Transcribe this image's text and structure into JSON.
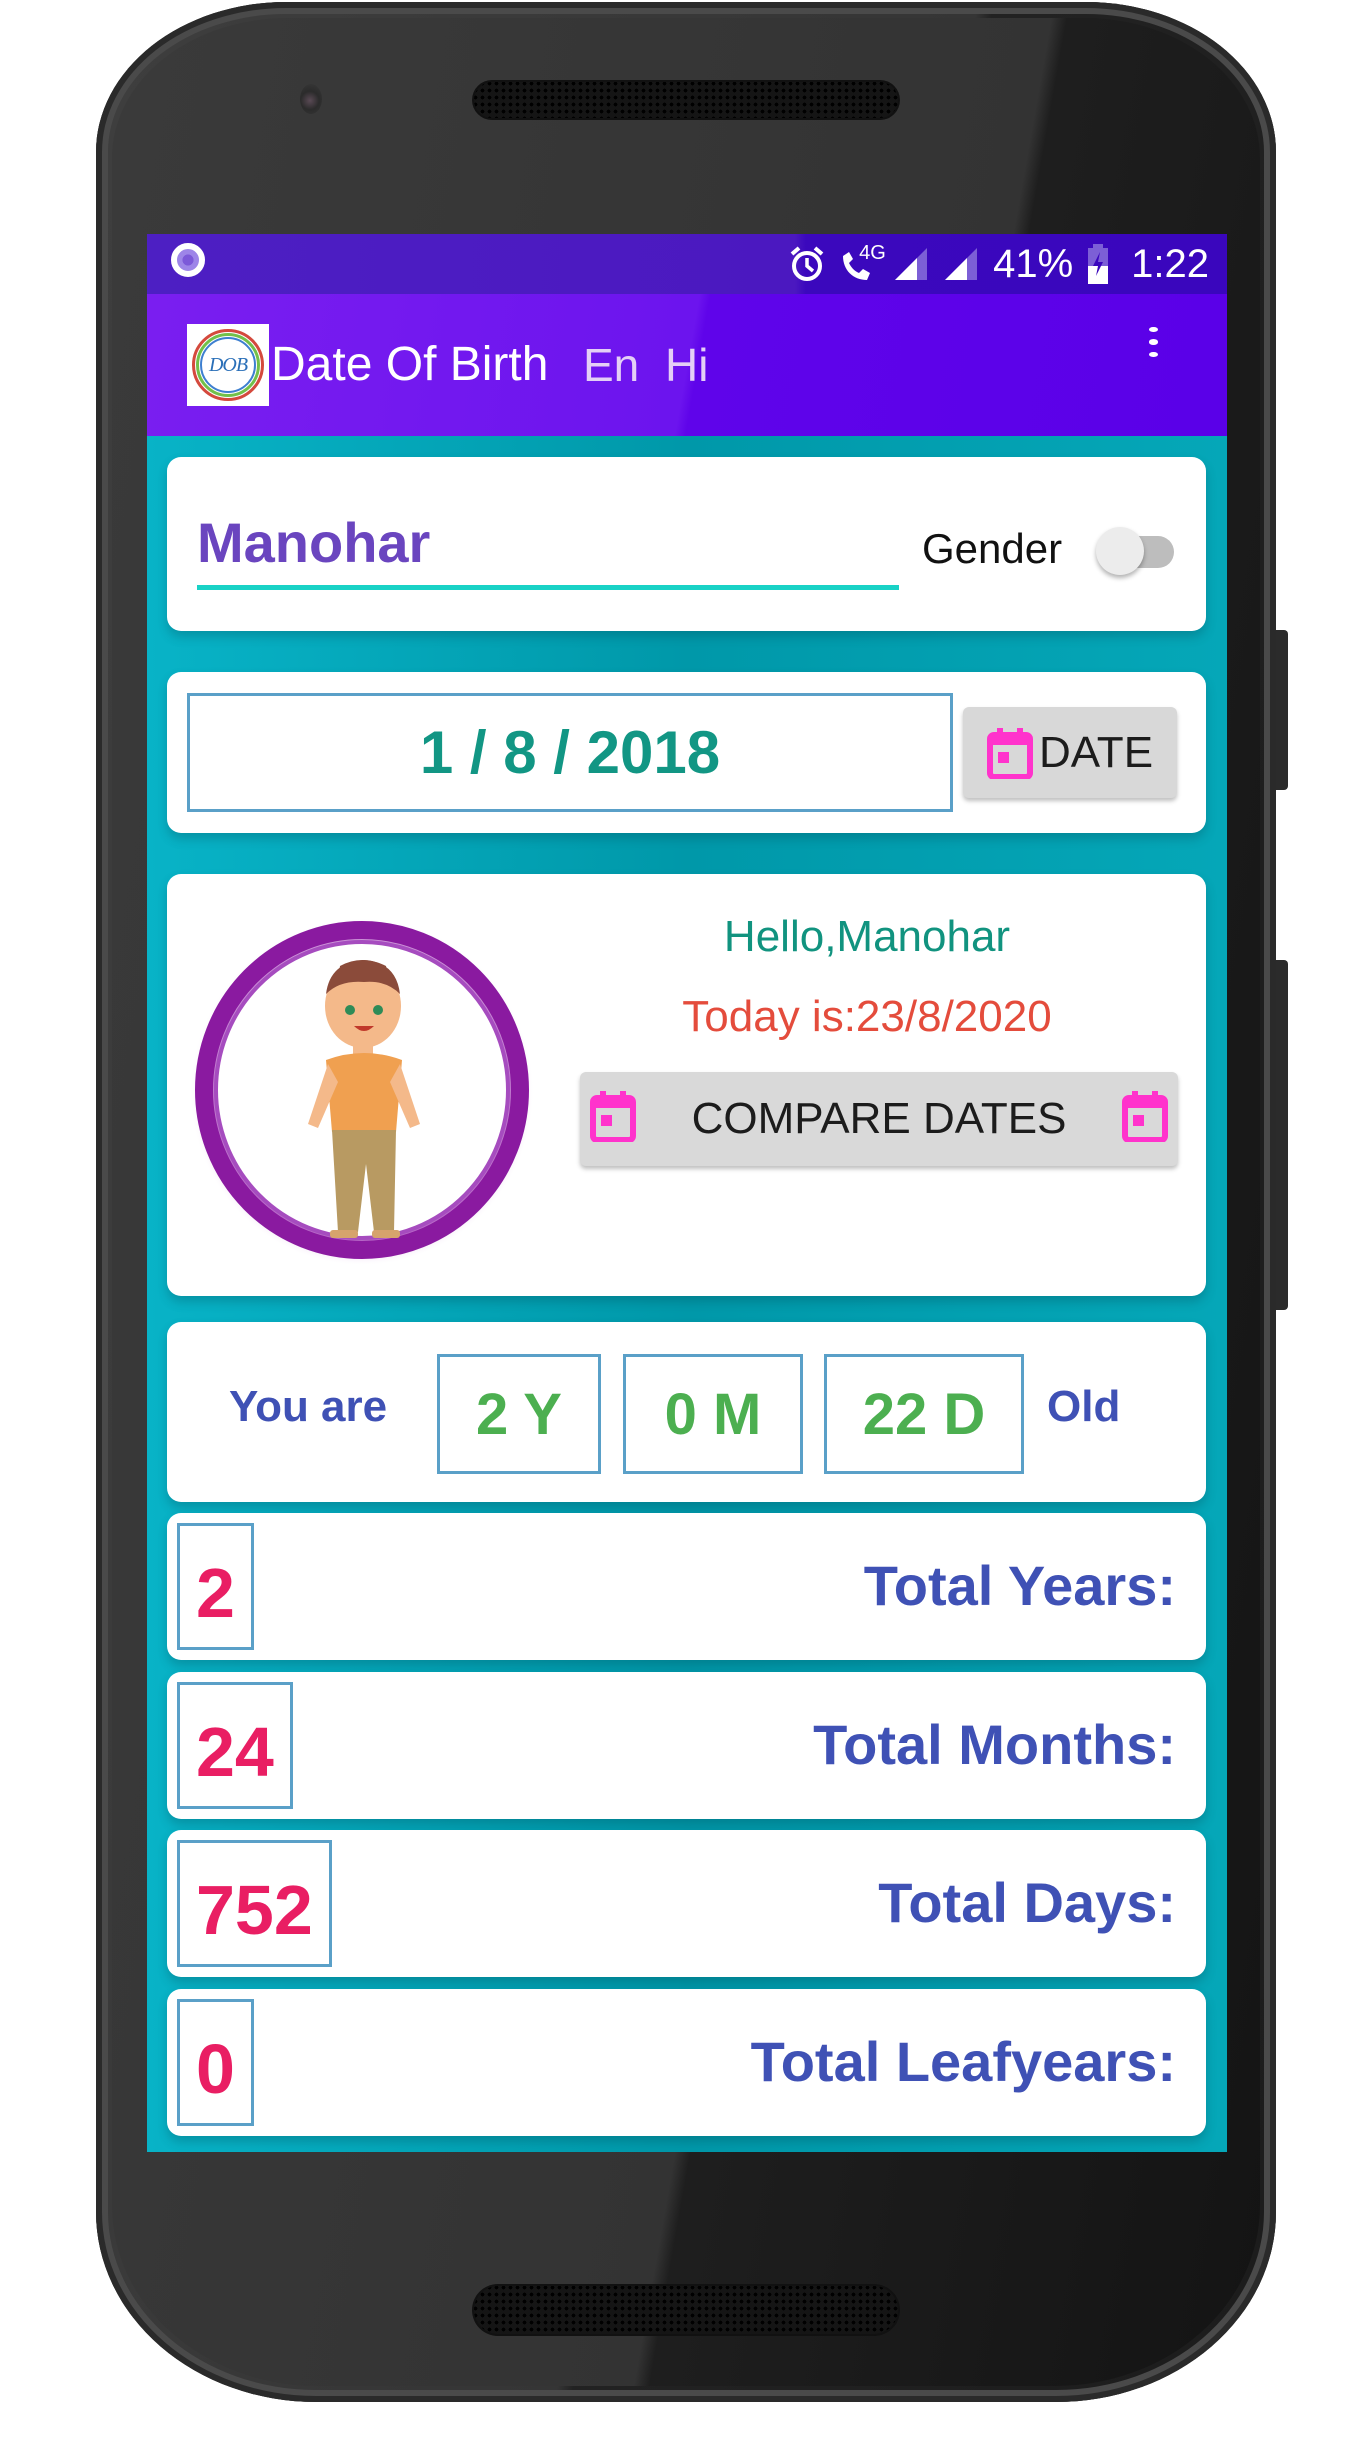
{
  "status_bar": {
    "time": "1:22",
    "battery_percent": "41%",
    "network_label": "4G",
    "icons": [
      "notification-dot-icon",
      "alarm-icon",
      "wifi-call-icon",
      "signal-icon",
      "signal-icon",
      "battery-charging-icon"
    ]
  },
  "app_bar": {
    "logo_text": "DOB",
    "title": "Date Of Birth",
    "lang_en": "En",
    "lang_hi": "Hi",
    "menu_icon": "more-vert-icon"
  },
  "name_card": {
    "name_value": "Manohar",
    "gender_label": "Gender",
    "gender_toggle_on": false
  },
  "date_card": {
    "dob_value": "1 / 8 / 2018",
    "date_button_label": "DATE",
    "date_button_icon": "calendar-icon"
  },
  "profile_card": {
    "greeting": "Hello,Manohar",
    "today": "Today is:23/8/2020",
    "compare_button_label": "COMPARE DATES",
    "avatar": "boy-avatar"
  },
  "age_card": {
    "prefix": "You are",
    "years": "2 Y",
    "months": "0 M",
    "days": "22 D",
    "suffix": "Old"
  },
  "stats": [
    {
      "value": "2",
      "label": "Total Years:"
    },
    {
      "value": "24",
      "label": "Total Months:"
    },
    {
      "value": "752",
      "label": "Total Days:"
    },
    {
      "value": "0",
      "label": "Total Leafyears:"
    }
  ],
  "colors": {
    "status_bar": "#4b18c0",
    "app_bar": "#6c14ee",
    "background": "#03a3b6",
    "name_text": "#6a45bf",
    "dob_text": "#129684",
    "greeting_text": "#11937f",
    "today_text": "#e44c3c",
    "age_text": "#4caf50",
    "label_text": "#3f51b5",
    "stat_value_text": "#e91e63",
    "calendar_icon": "#ff33cc"
  }
}
